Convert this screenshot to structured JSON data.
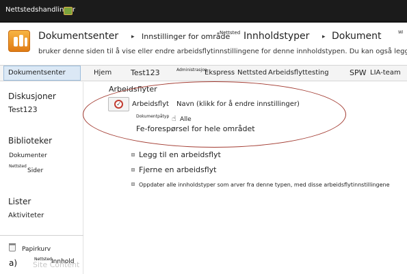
{
  "ribbon": {
    "site_actions": "Nettstedshandlinger"
  },
  "breadcrumb": {
    "items": [
      "Dokumentsenter",
      "Innstillinger for område",
      "Innholdstyper",
      "Dokument"
    ],
    "tiny_label": "Nettsted",
    "tiny_right": "Wi",
    "separator": "▸"
  },
  "page_description": "bruker denne siden til å vise eller endre arbeidsflytinnstillingene for denne innholdstypen. Du kan også legge til",
  "top_nav": {
    "selected": "Dokumentsenter",
    "items": [
      "Hjem",
      "Test123",
      "Administrasjon",
      "Ekspress",
      "Nettsted",
      "Arbeidsflyttesting",
      "SPW",
      "LIA-team"
    ]
  },
  "quick_launch": {
    "diskusjoner": "Diskusjoner",
    "test123": "Test123",
    "biblioteker": "Biblioteker",
    "dokumenter": "Dokumenter",
    "nettsted_tiny": "Nettsted",
    "sider": "Sider",
    "lister": "Lister",
    "aktiviteter": "Aktiviteter",
    "papirkurv": "Papirkurv",
    "bottom_a": "a)",
    "bottom_tiny": "Nettsted",
    "bottom_innhold": "Innhold",
    "bottom_ghost": "Site Content"
  },
  "workflows": {
    "section_title": "Arbeidsflyter",
    "col_workflow": "Arbeidsflyt",
    "col_name": "Navn (klikk for å endre innstillinger)",
    "tiny_label": "Dokumentpåtyp",
    "alle": "Alle",
    "row_name": "Fe-forespørsel for hele området"
  },
  "links": {
    "add": "Legg til en arbeidsflyt",
    "remove": "Fjerne en arbeidsflyt",
    "update": "Oppdater alle innholdstyper som arver fra denne typen, med disse arbeidsflytinnstillingene"
  },
  "colors": {
    "ribbon": "#1b1b1b",
    "highlight_ellipse": "#a23a30",
    "nav_selected": "#dbe8f5",
    "logo": "#f0a030"
  }
}
